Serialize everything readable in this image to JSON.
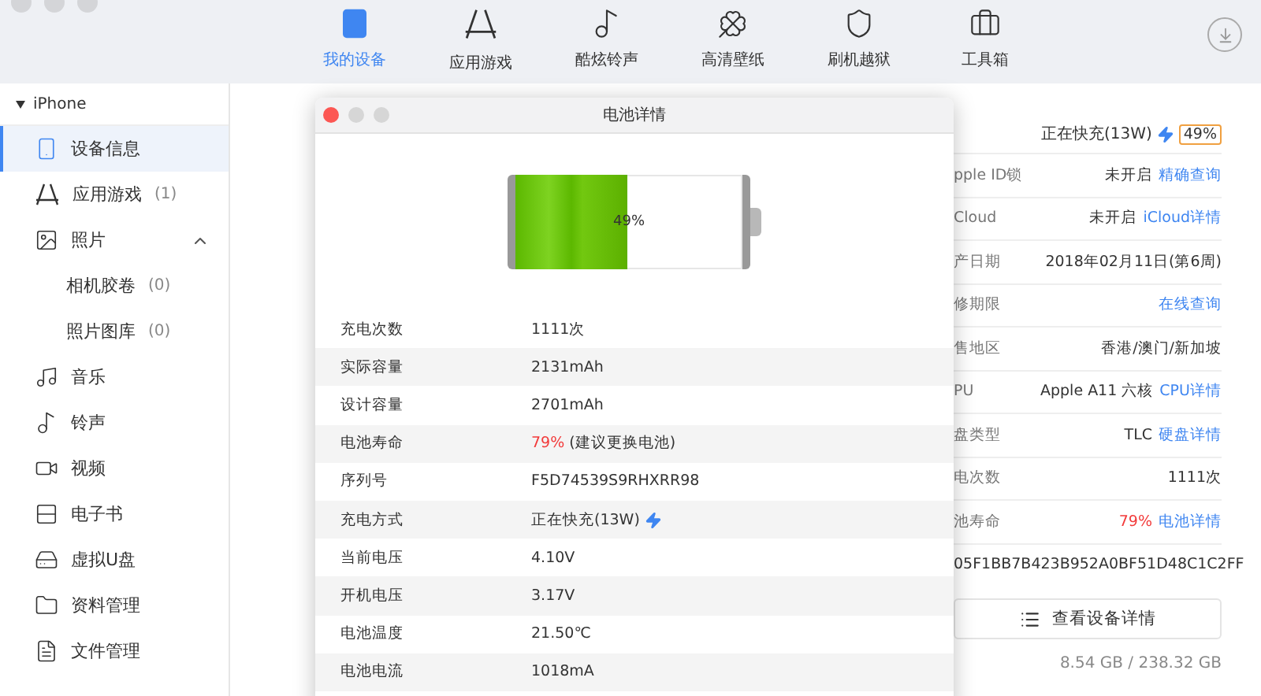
{
  "toolbar": {
    "tabs": [
      {
        "label": "我的设备",
        "selected": true
      },
      {
        "label": "应用游戏",
        "selected": false
      },
      {
        "label": "酷炫铃声",
        "selected": false
      },
      {
        "label": "高清壁纸",
        "selected": false
      },
      {
        "label": "刷机越狱",
        "selected": false
      },
      {
        "label": "工具箱",
        "selected": false
      }
    ]
  },
  "sidebar": {
    "device": {
      "label": "iPhone",
      "expanded": true
    },
    "items": [
      {
        "label": "设备信息",
        "selected": true
      },
      {
        "label": "应用游戏",
        "count": "(1)",
        "selected": false
      },
      {
        "label": "照片",
        "selected": false,
        "expanded": true,
        "children": [
          {
            "label": "相机胶卷",
            "count": "(0)",
            "selected": false
          },
          {
            "label": "照片图库",
            "count": "(0)",
            "selected": false
          }
        ]
      },
      {
        "label": "音乐",
        "selected": false
      },
      {
        "label": "铃声",
        "selected": false
      },
      {
        "label": "视频",
        "selected": false
      },
      {
        "label": "电子书",
        "selected": false
      },
      {
        "label": "虚拟U盘",
        "selected": false
      },
      {
        "label": "资料管理",
        "selected": false
      },
      {
        "label": "文件管理",
        "selected": false
      }
    ]
  },
  "info": {
    "status": {
      "text": "正在快充(13W)",
      "charging": true,
      "battery": "49%"
    },
    "rows": [
      {
        "label": "pple ID锁",
        "value": "未开启",
        "link": "精确查询"
      },
      {
        "label": "Cloud",
        "value": "未开启",
        "link": "iCloud详情"
      },
      {
        "label": "产日期",
        "value": "2018年02月11日(第6周)"
      },
      {
        "label": "修期限",
        "link": "在线查询"
      },
      {
        "label": "售地区",
        "value": "香港/澳门/新加坡"
      },
      {
        "label": "PU",
        "value": "Apple A11 六核",
        "link": "CPU详情"
      },
      {
        "label": "盘类型",
        "value": "TLC",
        "link": "硬盘详情"
      },
      {
        "label": "电次数",
        "value": "1111次"
      },
      {
        "label": "池寿命",
        "alert": "79%",
        "link": "电池详情"
      },
      {
        "value": "05F1BB7B423B952A0BF51D48C1C2FF"
      }
    ],
    "button": "查看设备详情",
    "storage": "8.54 GB / 238.32 GB"
  },
  "dialog": {
    "title": "电池详情",
    "battery": {
      "level": 0.49,
      "label": "49%"
    },
    "rows": [
      {
        "label": "充电次数",
        "value": "1111次"
      },
      {
        "label": "实际容量",
        "value": "2131mAh"
      },
      {
        "label": "设计容量",
        "value": "2701mAh"
      },
      {
        "label": "电池寿命",
        "alert": "79%",
        "value": "(建议更换电池)"
      },
      {
        "label": "序列号",
        "value": "F5D74539S9RHXRR98"
      },
      {
        "label": "充电方式",
        "value": "正在快充(13W)",
        "charging": true
      },
      {
        "label": "当前电压",
        "value": "4.10V"
      },
      {
        "label": "开机电压",
        "value": "3.17V"
      },
      {
        "label": "电池温度",
        "value": "21.50℃"
      },
      {
        "label": "电池电流",
        "value": "1018mA"
      }
    ]
  }
}
